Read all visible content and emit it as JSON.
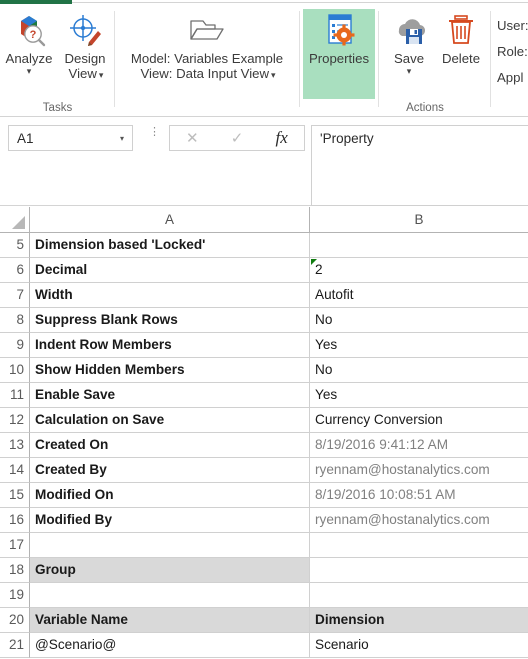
{
  "ribbon": {
    "tasks_group_label": "Tasks",
    "actions_group_label": "Actions",
    "items": {
      "analyze": {
        "label": "Analyze",
        "icon": "analyze-cube-magnifier-icon",
        "caret": "▾"
      },
      "design_view": {
        "label": "Design\nView",
        "label_line1": "Design",
        "label_line2": "View",
        "icon": "crosshair-pencil-icon",
        "caret": "▾"
      },
      "model_view": {
        "icon": "open-folder-icon",
        "line1": "Model: Variables Example",
        "line2": "View: Data Input View",
        "caret": "▾"
      },
      "properties": {
        "label": "Properties",
        "icon": "properties-gear-list-icon",
        "highlight_color": "#a9dfbf"
      },
      "save": {
        "label": "Save",
        "icon": "cloud-save-icon",
        "caret": "▾"
      },
      "delete": {
        "label": "Delete",
        "icon": "trash-can-icon"
      }
    }
  },
  "user_panel": {
    "user_label": "User:",
    "role_label": "Role:",
    "application_label": "Appl"
  },
  "formula_bar": {
    "name_box_value": "A1",
    "name_box_caret": "▾",
    "cancel_icon": "✕",
    "enter_icon": "✓",
    "fx_label": "fx",
    "formula_value": "'Property",
    "handle_icon": "⋮"
  },
  "grid": {
    "columns": [
      "A",
      "B"
    ],
    "rows": [
      {
        "num": "5",
        "a": "Dimension based 'Locked'",
        "b": "",
        "a_bold": true,
        "b_bold": false,
        "b_muted": false,
        "shade": "none"
      },
      {
        "num": "6",
        "a": "Decimal",
        "b": "2",
        "a_bold": true,
        "b_bold": false,
        "b_muted": false,
        "shade": "none",
        "b_error_flag": true
      },
      {
        "num": "7",
        "a": "Width",
        "b": "Autofit",
        "a_bold": true,
        "b_bold": false,
        "b_muted": false,
        "shade": "none"
      },
      {
        "num": "8",
        "a": "Suppress Blank Rows",
        "b": "No",
        "a_bold": true,
        "b_bold": false,
        "b_muted": false,
        "shade": "none"
      },
      {
        "num": "9",
        "a": "Indent Row Members",
        "b": "Yes",
        "a_bold": true,
        "b_bold": false,
        "b_muted": false,
        "shade": "none"
      },
      {
        "num": "10",
        "a": "Show Hidden Members",
        "b": "No",
        "a_bold": true,
        "b_bold": false,
        "b_muted": false,
        "shade": "none"
      },
      {
        "num": "11",
        "a": "Enable Save",
        "b": "Yes",
        "a_bold": true,
        "b_bold": false,
        "b_muted": false,
        "shade": "none"
      },
      {
        "num": "12",
        "a": "Calculation on Save",
        "b": "Currency Conversion",
        "a_bold": true,
        "b_bold": false,
        "b_muted": false,
        "shade": "none"
      },
      {
        "num": "13",
        "a": "Created On",
        "b": "8/19/2016 9:41:12 AM",
        "a_bold": true,
        "b_bold": false,
        "b_muted": true,
        "shade": "none"
      },
      {
        "num": "14",
        "a": "Created By",
        "b": "ryennam@hostanalytics.com",
        "a_bold": true,
        "b_bold": false,
        "b_muted": true,
        "shade": "none"
      },
      {
        "num": "15",
        "a": "Modified On",
        "b": "8/19/2016 10:08:51 AM",
        "a_bold": true,
        "b_bold": false,
        "b_muted": true,
        "shade": "none"
      },
      {
        "num": "16",
        "a": "Modified By",
        "b": "ryennam@hostanalytics.com",
        "a_bold": true,
        "b_bold": false,
        "b_muted": true,
        "shade": "none"
      },
      {
        "num": "17",
        "a": "",
        "b": "",
        "a_bold": false,
        "b_bold": false,
        "b_muted": false,
        "shade": "none"
      },
      {
        "num": "18",
        "a": "Group",
        "b": "",
        "a_bold": true,
        "b_bold": false,
        "b_muted": false,
        "shade": "a"
      },
      {
        "num": "19",
        "a": "",
        "b": "",
        "a_bold": false,
        "b_bold": false,
        "b_muted": false,
        "shade": "none"
      },
      {
        "num": "20",
        "a": "Variable Name",
        "b": "Dimension",
        "a_bold": true,
        "b_bold": true,
        "b_muted": false,
        "shade": "both"
      },
      {
        "num": "21",
        "a": "@Scenario@",
        "b": "Scenario",
        "a_bold": false,
        "b_bold": false,
        "b_muted": false,
        "shade": "none"
      }
    ]
  },
  "colors": {
    "excel_green": "#217346",
    "properties_highlight": "#a9dfbf",
    "shade_gray": "#d9d9d9",
    "error_triangle_green": "#107c10"
  }
}
